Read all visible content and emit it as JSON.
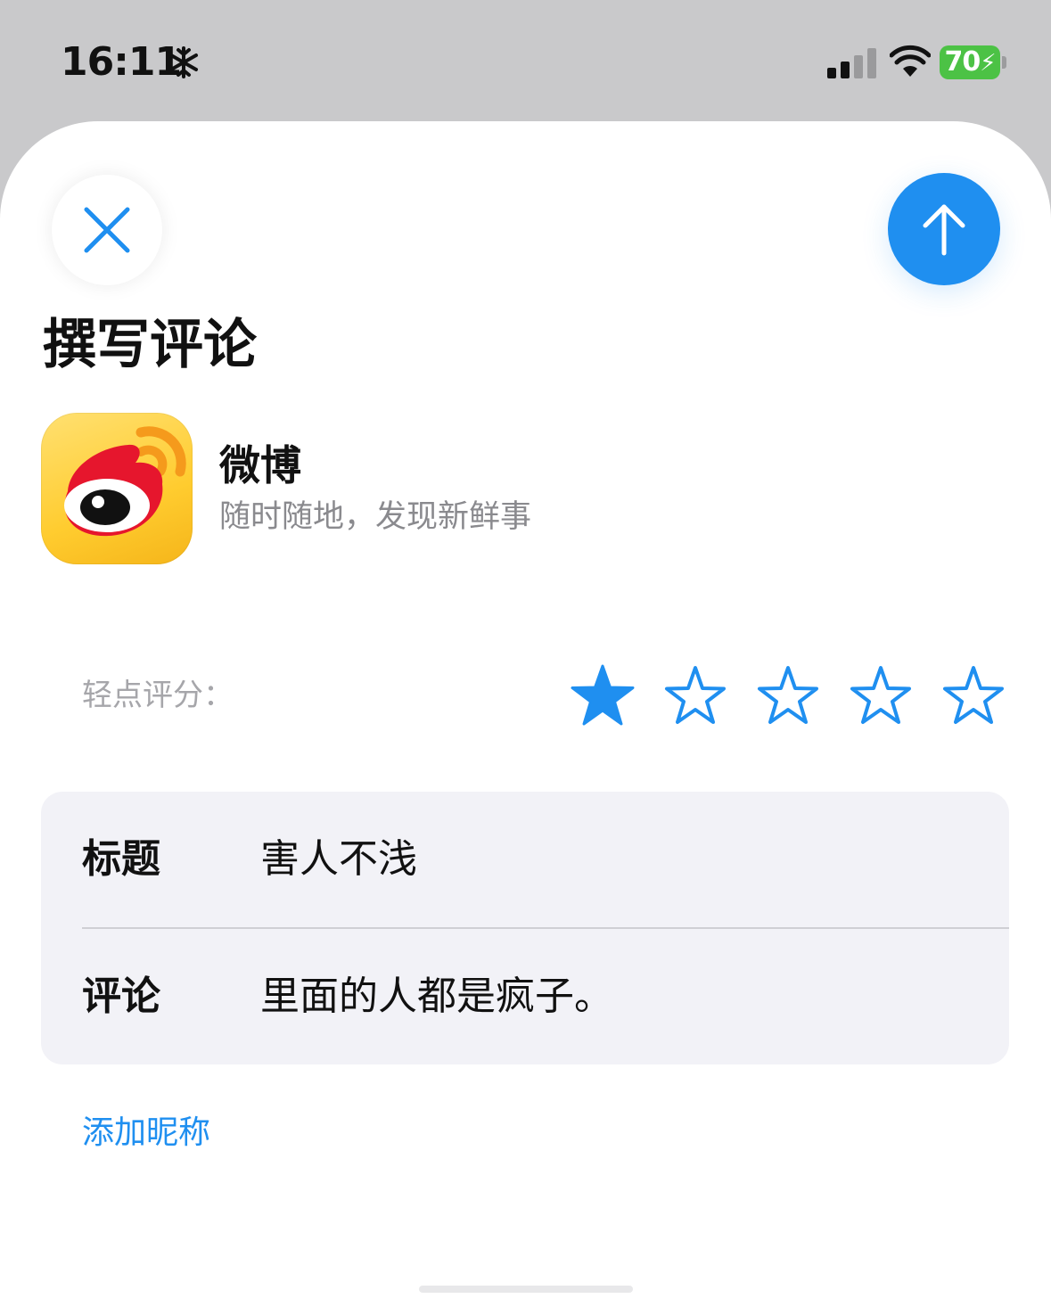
{
  "status_bar": {
    "time": "16:11",
    "battery_level": "70"
  },
  "colors": {
    "accent": "#1f8ff0",
    "battery": "#4cc245",
    "card": "#f2f2f7"
  },
  "icons": {
    "close": "close-icon",
    "submit": "arrow-up-icon",
    "star_filled": "star-filled-icon",
    "star_empty": "star-outline-icon"
  },
  "page": {
    "title": "撰写评论"
  },
  "app": {
    "name": "微博",
    "subtitle": "随时随地，发现新鲜事"
  },
  "rating": {
    "label": "轻点评分：",
    "value": 1,
    "max": 5
  },
  "form": {
    "title_label": "标题",
    "title_value": "害人不浅",
    "comment_label": "评论",
    "comment_value": "里面的人都是疯子。"
  },
  "add_nickname": "添加昵称"
}
